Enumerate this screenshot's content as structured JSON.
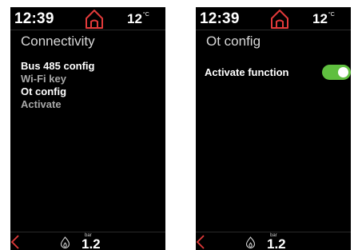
{
  "colors": {
    "accent": "#e23a3a",
    "toggle_on": "#5fbf3f",
    "background": "#000000",
    "dim_text": "#a8a8a8"
  },
  "left": {
    "status": {
      "time": "12:39",
      "temperature": "12",
      "temp_unit": "°C",
      "home_icon": "home-icon"
    },
    "title": "Connectivity",
    "menu": [
      {
        "label": "Bus 485 config"
      },
      {
        "label": "Wi-Fi key"
      },
      {
        "label": "Ot config"
      },
      {
        "label": "Activate"
      }
    ],
    "bottom": {
      "back_icon": "chevron-left-icon",
      "flame_icon": "flame-icon",
      "pressure_unit": "bar",
      "pressure_value": "1.2"
    }
  },
  "right": {
    "status": {
      "time": "12:39",
      "temperature": "12",
      "temp_unit": "°C",
      "home_icon": "home-icon"
    },
    "title": "Ot config",
    "option": {
      "label": "Activate function",
      "enabled": true
    },
    "bottom": {
      "back_icon": "chevron-left-icon",
      "flame_icon": "flame-icon",
      "pressure_unit": "bar",
      "pressure_value": "1.2"
    }
  }
}
